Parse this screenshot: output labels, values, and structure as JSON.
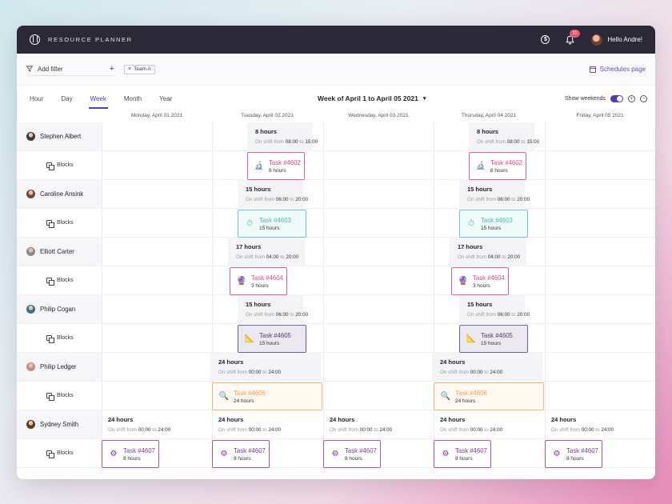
{
  "header": {
    "brand": "RESOURCE PLANNER",
    "notification_count": "11",
    "coin_symbol": "$",
    "greeting": "Hello Andre!"
  },
  "filters": {
    "add_filter_label": "Add filter",
    "add_symbol": "+",
    "chip_label": "Team A",
    "chip_close": "×",
    "schedules_link": "Schedules page"
  },
  "tabs": [
    "Hour",
    "Day",
    "Week",
    "Month",
    "Year"
  ],
  "active_tab": "Week",
  "week_title": "Week of April 1 to April 05 2021",
  "show_weekends_label": "Show weekends",
  "show_weekends": true,
  "zoom_in": "+",
  "zoom_out": "−",
  "days": [
    "Monday, April 01 2021",
    "Tuesday, April 02 2021",
    "Wednesday, April 03 2021",
    "Thursday, April 04 2021",
    "Friday, April 05 2021"
  ],
  "blocks_label": "Blocks",
  "shift_prefix": "On shift from",
  "shift_to": "to",
  "people": [
    {
      "name": "Stephen Albert",
      "avatar_color": "#3a3a3a",
      "shifts": [
        {
          "day": 1,
          "hours": "8 hours",
          "from": "08:00",
          "to": "15:00"
        },
        {
          "day": 3,
          "hours": "8 hours",
          "from": "08:00",
          "to": "15:00"
        }
      ],
      "task": {
        "title": "Task #4602",
        "hours": "6 hours",
        "style": "pink",
        "icon": "🔬",
        "icon_name": "microscope-icon",
        "days": [
          1,
          3
        ]
      }
    },
    {
      "name": "Caroline Ansink",
      "avatar_color": "#6b4a3a",
      "shifts": [
        {
          "day": 1,
          "hours": "15 hours",
          "from": "06:00",
          "to": "20:00"
        },
        {
          "day": 3,
          "hours": "15 hours",
          "from": "06:00",
          "to": "20:00"
        }
      ],
      "task": {
        "title": "Task #4603",
        "hours": "15 hours",
        "style": "teal",
        "icon": "⏱",
        "icon_name": "stopwatch-icon",
        "days": [
          1,
          3
        ]
      }
    },
    {
      "name": "Elliott Carter",
      "avatar_color": "#8a8a8a",
      "shifts": [
        {
          "day": 1,
          "hours": "17 hours",
          "from": "04:00",
          "to": "20:00"
        },
        {
          "day": 3,
          "hours": "17 hours",
          "from": "04:00",
          "to": "20:00"
        }
      ],
      "task": {
        "title": "Task #4604",
        "hours": "3 hours",
        "style": "pink",
        "icon": "🔮",
        "icon_name": "crystal-ball-icon",
        "days": [
          1,
          3
        ]
      }
    },
    {
      "name": "Philip Cogan",
      "avatar_color": "#3b6f8f",
      "shifts": [
        {
          "day": 1,
          "hours": "15 hours",
          "from": "06:00",
          "to": "20:00"
        },
        {
          "day": 3,
          "hours": "15 hours",
          "from": "06:00",
          "to": "20:00"
        }
      ],
      "task": {
        "title": "Task #4605",
        "hours": "15 hours",
        "style": "lav",
        "icon": "📐",
        "icon_name": "ruler-icon",
        "days": [
          1,
          3
        ]
      }
    },
    {
      "name": "Philip Ledger",
      "avatar_color": "#c78a8a",
      "shifts": [
        {
          "day": 1,
          "hours": "24 hours",
          "from": "00:00",
          "to": "24:00"
        },
        {
          "day": 3,
          "hours": "24 hours",
          "from": "00:00",
          "to": "24:00"
        }
      ],
      "task": {
        "title": "Task #4606",
        "hours": "24 hours",
        "style": "orange",
        "icon": "🔍",
        "icon_name": "magnifier-icon",
        "days": [
          1,
          3
        ]
      }
    },
    {
      "name": "Sydney Smith",
      "avatar_color": "#5a3b2a",
      "shifts": [
        {
          "day": 0,
          "hours": "24 hours",
          "from": "00:00",
          "to": "24:00"
        },
        {
          "day": 1,
          "hours": "24 hours",
          "from": "00:00",
          "to": "24:00"
        },
        {
          "day": 2,
          "hours": "24 hours",
          "from": "00:00",
          "to": "24:00"
        },
        {
          "day": 3,
          "hours": "24 hours",
          "from": "00:00",
          "to": "24:00"
        },
        {
          "day": 4,
          "hours": "24 hours",
          "from": "00:00",
          "to": "24:00"
        }
      ],
      "task": {
        "title": "Task #4607",
        "hours": "8 hours",
        "style": "purple",
        "icon": "⚙",
        "icon_name": "gear-icon",
        "days": [
          0,
          1,
          2,
          3,
          4
        ]
      }
    }
  ]
}
